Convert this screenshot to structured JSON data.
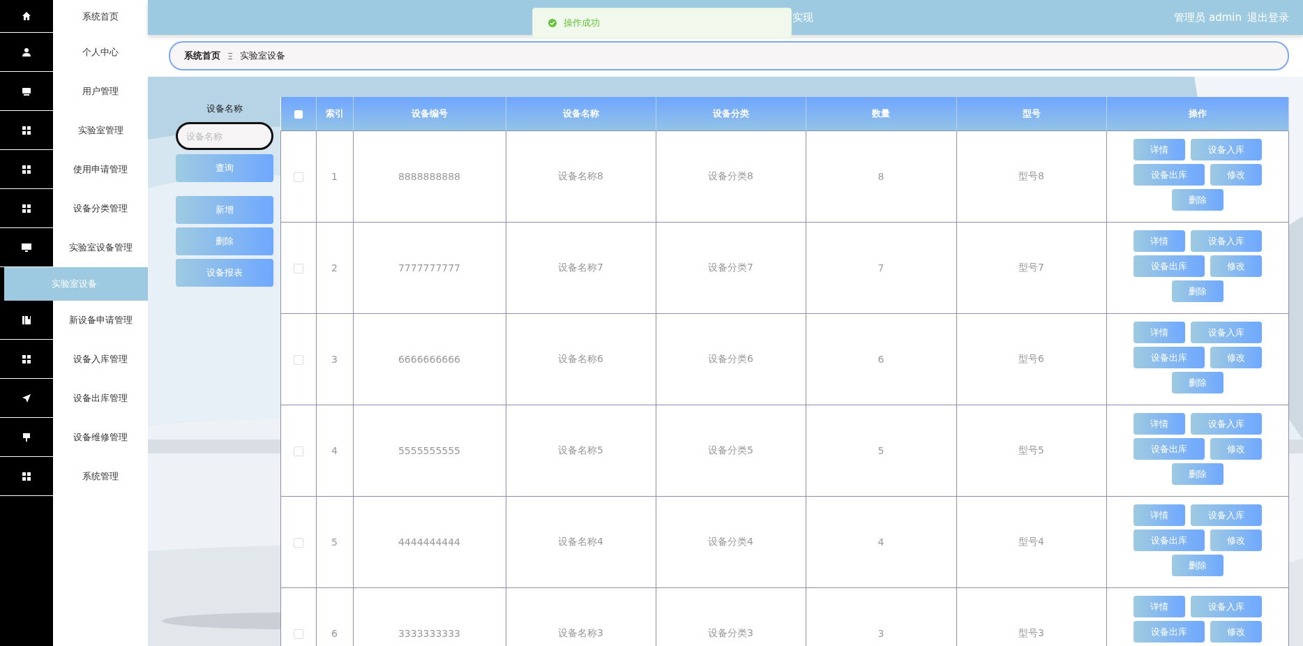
{
  "header": {
    "title": "实现",
    "user": "管理员 admin",
    "logout": "退出登录"
  },
  "toast": {
    "text": "操作成功"
  },
  "sidebar": {
    "items": [
      {
        "label": "系统首页",
        "selected": false
      },
      {
        "label": "个人中心",
        "selected": false
      },
      {
        "label": "用户管理",
        "selected": false
      },
      {
        "label": "实验室管理",
        "selected": false
      },
      {
        "label": "使用申请管理",
        "selected": false
      },
      {
        "label": "设备分类管理",
        "selected": false
      },
      {
        "label": "实验室设备管理",
        "selected": false,
        "expanded": true,
        "children": [
          {
            "label": "实验室设备",
            "selected": true
          }
        ]
      },
      {
        "label": "新设备申请管理",
        "selected": false
      },
      {
        "label": "设备入库管理",
        "selected": false
      },
      {
        "label": "设备出库管理",
        "selected": false
      },
      {
        "label": "设备维修管理",
        "selected": false
      },
      {
        "label": "系统管理",
        "selected": false
      }
    ]
  },
  "breadcrumb": {
    "items": [
      "系统首页",
      "实验室设备"
    ],
    "separator": "Ξ"
  },
  "filter": {
    "label": "设备名称",
    "placeholder": "设备名称",
    "search_button": "查询",
    "buttons": [
      "新增",
      "删除",
      "设备报表"
    ]
  },
  "table": {
    "select_all": {
      "checked": false
    },
    "columns": [
      "索引",
      "设备编号",
      "设备名称",
      "设备分类",
      "数量",
      "型号",
      "操作"
    ],
    "rows": [
      {
        "checked": false,
        "cells": [
          "1",
          "8888888888",
          "设备名称8",
          "设备分类8",
          "8",
          "型号8"
        ],
        "actions": [
          "详情",
          "设备入库",
          "设备出库",
          "修改",
          "删除"
        ]
      },
      {
        "checked": false,
        "cells": [
          "2",
          "7777777777",
          "设备名称7",
          "设备分类7",
          "7",
          "型号7"
        ],
        "actions": [
          "详情",
          "设备入库",
          "设备出库",
          "修改",
          "删除"
        ]
      },
      {
        "checked": false,
        "cells": [
          "3",
          "6666666666",
          "设备名称6",
          "设备分类6",
          "6",
          "型号6"
        ],
        "actions": [
          "详情",
          "设备入库",
          "设备出库",
          "修改",
          "删除"
        ]
      },
      {
        "checked": false,
        "cells": [
          "4",
          "5555555555",
          "设备名称5",
          "设备分类5",
          "5",
          "型号5"
        ],
        "actions": [
          "详情",
          "设备入库",
          "设备出库",
          "修改",
          "删除"
        ]
      },
      {
        "checked": false,
        "cells": [
          "5",
          "4444444444",
          "设备名称4",
          "设备分类4",
          "4",
          "型号4"
        ],
        "actions": [
          "详情",
          "设备入库",
          "设备出库",
          "修改",
          "删除"
        ]
      },
      {
        "checked": false,
        "cells": [
          "6",
          "3333333333",
          "设备名称3",
          "设备分类3",
          "3",
          "型号3"
        ],
        "actions": [
          "详情",
          "设备入库",
          "设备出库",
          "修改"
        ]
      }
    ]
  }
}
